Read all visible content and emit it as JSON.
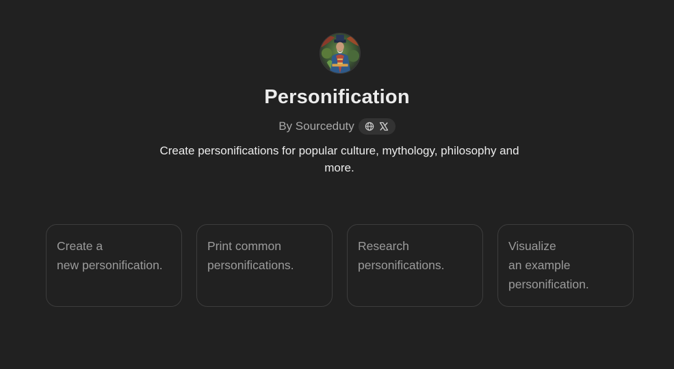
{
  "gpt": {
    "name": "Personification",
    "author": "By Sourceduty",
    "description": "Create personifications for popular culture, mythology, philosophy and more.",
    "avatar_icon": "robed-figure-avatar",
    "links": [
      {
        "icon": "globe-icon"
      },
      {
        "icon": "x-logo-icon"
      }
    ]
  },
  "conversation_starters": [
    {
      "lines": [
        "Create a",
        "new personification."
      ]
    },
    {
      "lines": [
        "Print common",
        "personifications."
      ]
    },
    {
      "lines": [
        "Research",
        "personifications."
      ]
    },
    {
      "lines": [
        "Visualize",
        "an example",
        "personification."
      ]
    }
  ],
  "colors": {
    "background": "#212121",
    "card_border": "#3d3d3d",
    "card_text": "#9b9b9b",
    "title_text": "#ececec",
    "muted_text": "#a8a8a8",
    "pill_bg": "#333333"
  }
}
